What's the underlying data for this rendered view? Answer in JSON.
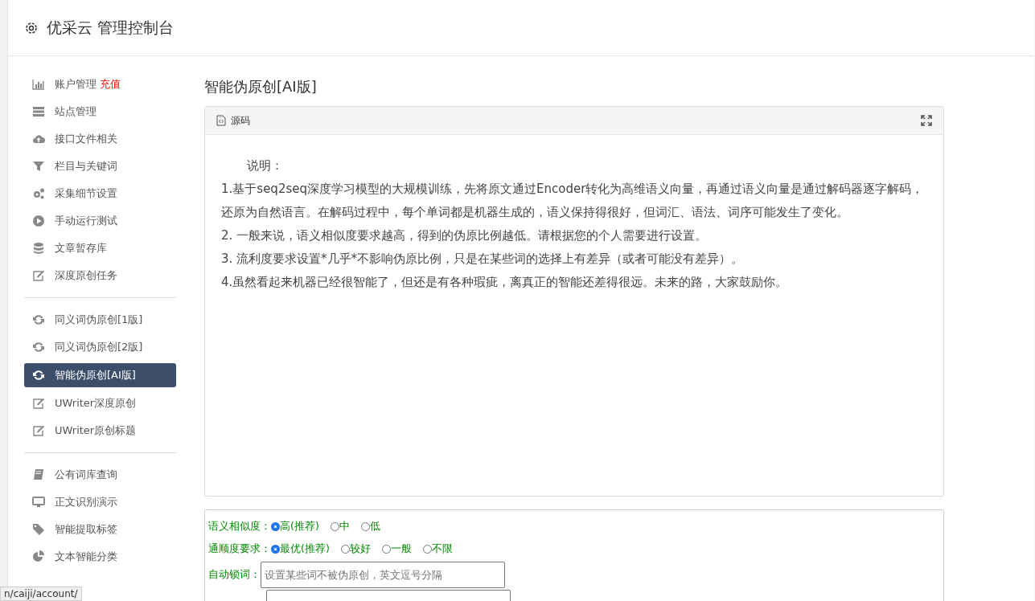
{
  "header": {
    "title": "优采云 管理控制台"
  },
  "sidebar": {
    "groups": [
      {
        "items": [
          {
            "label": "账户管理",
            "badge": "充值",
            "kind": "chart",
            "selected": false
          },
          {
            "label": "站点管理",
            "kind": "server",
            "selected": false
          },
          {
            "label": "接口文件相关",
            "kind": "cloud",
            "selected": false
          },
          {
            "label": "栏目与关键词",
            "kind": "filter",
            "selected": false
          },
          {
            "label": "采集细节设置",
            "kind": "gears",
            "selected": false
          },
          {
            "label": "手动运行测试",
            "kind": "play",
            "selected": false
          },
          {
            "label": "文章暂存库",
            "kind": "database",
            "selected": false
          },
          {
            "label": "深度原创任务",
            "kind": "edit",
            "selected": false
          }
        ]
      },
      {
        "items": [
          {
            "label": "同义词伪原创[1版]",
            "kind": "refresh",
            "selected": false
          },
          {
            "label": "同义词伪原创[2版]",
            "kind": "refresh",
            "selected": false
          },
          {
            "label": "智能伪原创[AI版]",
            "kind": "refresh",
            "selected": true
          },
          {
            "label": "UWriter深度原创",
            "kind": "edit",
            "selected": false
          },
          {
            "label": "UWriter原创标题",
            "kind": "edit",
            "selected": false
          }
        ]
      },
      {
        "items": [
          {
            "label": "公有词库查询",
            "kind": "book",
            "selected": false
          },
          {
            "label": "正文识别演示",
            "kind": "monitor",
            "selected": false
          },
          {
            "label": "智能提取标签",
            "kind": "tag",
            "selected": false
          },
          {
            "label": "文本智能分类",
            "kind": "pie",
            "selected": false
          }
        ]
      }
    ]
  },
  "main": {
    "title": "智能伪原创[AI版]",
    "editor": {
      "toolbar_label": "源码",
      "lines": [
        "说明：",
        "1.基于seq2seq深度学习模型的大规模训练，先将原文通过Encoder转化为高维语义向量，再通过语义向量是通过解码器逐字解码，还原为自然语言。在解码过程中，每个单词都是机器生成的，语义保持得很好，但词汇、语法、词序可能发生了变化。",
        "2. 一般来说，语义相似度要求越高，得到的伪原比例越低。请根据您的个人需要进行设置。",
        "3. 流利度要求设置*几乎*不影响伪原比例，只是在某些词的选择上有差异（或者可能没有差异）。",
        "4.虽然看起来机器已经很智能了，但还是有各种瑕疵，离真正的智能还差得很远。未来的路，大家鼓励你。"
      ]
    },
    "options": [
      {
        "label": "语义相似度：",
        "choices": [
          {
            "label": "高(推荐)",
            "selected": true
          },
          {
            "label": "中",
            "selected": false
          },
          {
            "label": "低",
            "selected": false
          }
        ]
      },
      {
        "label": "通顺度要求：",
        "choices": [
          {
            "label": "最优(推荐)",
            "selected": true
          },
          {
            "label": "较好",
            "selected": false
          },
          {
            "label": "一般",
            "selected": false
          },
          {
            "label": "不限",
            "selected": false
          }
        ]
      }
    ],
    "lock_words": {
      "label": "自动锁词：",
      "placeholder": "设置某些词不被伪原创，英文逗号分隔"
    }
  },
  "status_url": "n/caiji/account/"
}
